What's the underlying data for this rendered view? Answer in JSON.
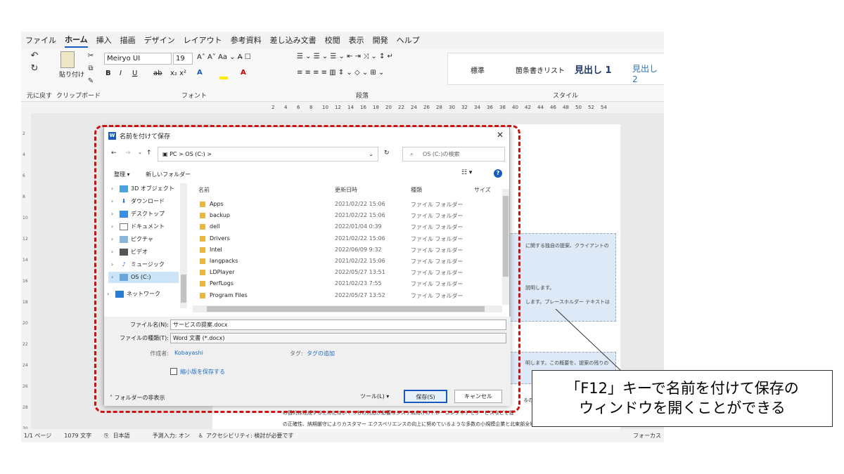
{
  "menu": {
    "items": [
      "ファイル",
      "ホーム",
      "挿入",
      "描画",
      "デザイン",
      "レイアウト",
      "参考資料",
      "差し込み文書",
      "校閲",
      "表示",
      "開発",
      "ヘルプ"
    ],
    "active": "ホーム"
  },
  "ribbon": {
    "undo_label": "元に戻す",
    "clipboard_label": "クリップボード",
    "paste_label": "貼り付け",
    "font_label": "フォント",
    "paragraph_label": "段落",
    "styles_label": "スタイル",
    "font_name": "Meiryo UI",
    "font_size": "19",
    "styles": [
      "標準",
      "箇条書きリスト",
      "見出し 1",
      "見出し 2"
    ]
  },
  "ruler": {
    "ticks": [
      "2",
      "4",
      "6",
      "8",
      "10",
      "12",
      "14",
      "16",
      "18",
      "20",
      "22",
      "24",
      "26",
      "28",
      "30",
      "32",
      "34",
      "36",
      "38",
      "40",
      "42",
      "44",
      "46",
      "48",
      "50",
      "52",
      "54"
    ]
  },
  "vruler": {
    "ticks": [
      "2",
      "4",
      "6",
      "8",
      "10",
      "12",
      "14",
      "16",
      "18",
      "20",
      "22",
      "24",
      "26",
      "28",
      "30"
    ]
  },
  "document": {
    "ph1_line1": "に関する独自の提案、クライアントの",
    "ph1_line2": "説明します。",
    "ph1_line3": "します。プレースホルダー テキストは",
    "ph2_line1": "明します。この概要を、提案の残りの",
    "line_a": "るのサポ",
    "line_b": "の目的は達成するためにはいくつもの対応が必要なシステム向けのトレーニングやデモサービスなどを提",
    "line_c": "の正確性、納期厳守によりカスタマー エクスペリエンスの向上に努めているような多数の小規模企業と北東部全域にわたって"
  },
  "status": {
    "page": "1/1 ページ",
    "words": "1079 文字",
    "lang": "日本語",
    "ime": "予測入力: オン",
    "access": "アクセシビリティ: 検討が必要です",
    "focus": "フォーカス"
  },
  "dialog": {
    "title": "名前を付けて保存",
    "address": "PC  >  OS (C:)  >",
    "search_placeholder": "OS (C:)の検索",
    "organize": "整理 ▾",
    "new_folder": "新しいフォルダー",
    "tree": [
      "3D オブジェクト",
      "ダウンロード",
      "デスクトップ",
      "ドキュメント",
      "ピクチャ",
      "ビデオ",
      "ミュージック",
      "OS (C:)",
      "ネットワーク"
    ],
    "columns": {
      "name": "名前",
      "date": "更新日時",
      "type": "種類",
      "size": "サイズ"
    },
    "files": [
      {
        "name": "Apps",
        "date": "2021/02/22 15:06",
        "type": "ファイル フォルダー"
      },
      {
        "name": "backup",
        "date": "2021/02/22 15:06",
        "type": "ファイル フォルダー"
      },
      {
        "name": "dell",
        "date": "2022/01/04 0:39",
        "type": "ファイル フォルダー"
      },
      {
        "name": "Drivers",
        "date": "2021/02/22 15:06",
        "type": "ファイル フォルダー"
      },
      {
        "name": "Intel",
        "date": "2022/06/09 9:32",
        "type": "ファイル フォルダー"
      },
      {
        "name": "langpacks",
        "date": "2021/02/22 15:06",
        "type": "ファイル フォルダー"
      },
      {
        "name": "LDPlayer",
        "date": "2022/05/27 13:51",
        "type": "ファイル フォルダー"
      },
      {
        "name": "PerfLogs",
        "date": "2021/02/23 7:55",
        "type": "ファイル フォルダー"
      },
      {
        "name": "Program Files",
        "date": "2022/05/27 13:52",
        "type": "ファイル フォルダー"
      }
    ],
    "filename_label": "ファイル名(N):",
    "filename": "サービスの提案.docx",
    "filetype_label": "ファイルの種類(T):",
    "filetype": "Word 文書 (*.docx)",
    "author_label": "作成者:",
    "author": "Kobayashi",
    "tag_label": "タグ:",
    "tag": "タグの追加",
    "thumbnail": "縮小版を保存する",
    "hide_folders": "フォルダーの非表示",
    "tools": "ツール(L)",
    "save": "保存(S)",
    "cancel": "キャンセル"
  },
  "callout": {
    "line1": "「F12」キーで名前を付けて保存の",
    "line2": "ウィンドウを開くことができる"
  },
  "colors": {
    "accent": "#185abd",
    "highlight": "#cc1111"
  }
}
